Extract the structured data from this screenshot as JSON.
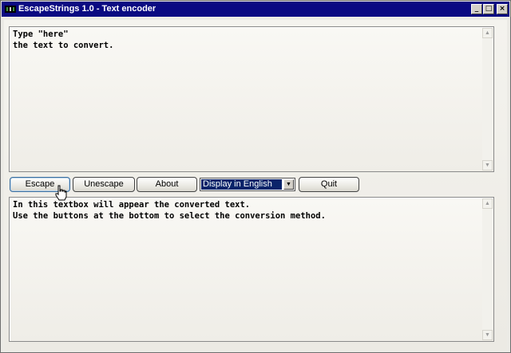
{
  "window": {
    "title": "EscapeStrings 1.0 - Text encoder",
    "controls": {
      "minimize": "_",
      "maximize": "□",
      "close": "×"
    }
  },
  "input_box": {
    "text": "Type \"here\"\nthe text to convert."
  },
  "output_box": {
    "text": "In this textbox will appear the converted text.\nUse the buttons at the bottom to select the conversion method."
  },
  "toolbar": {
    "escape_label": "Escape",
    "unescape_label": "Unescape",
    "about_label": "About",
    "language_select": {
      "selected": "Display in English"
    },
    "quit_label": "Quit"
  },
  "icons": {
    "scroll_up": "▲",
    "scroll_down": "▼",
    "dropdown": "▼",
    "app_icon": "app-icon",
    "cursor": "hand-pointer-icon"
  },
  "colors": {
    "titlebar": "#0a0a82",
    "selection": "#0a246a"
  }
}
